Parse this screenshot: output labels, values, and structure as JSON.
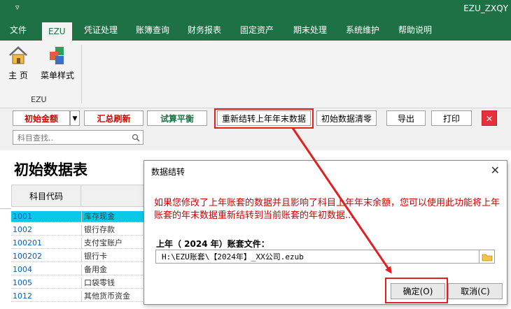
{
  "titlebar": {
    "quick_access": "▿",
    "app_title": "EZU_ZXQY"
  },
  "tabs": [
    {
      "label": "文件"
    },
    {
      "label": "EZU"
    },
    {
      "label": "凭证处理"
    },
    {
      "label": "账簿查询"
    },
    {
      "label": "财务报表"
    },
    {
      "label": "固定资产"
    },
    {
      "label": "期末处理"
    },
    {
      "label": "系统维护"
    },
    {
      "label": "帮助说明"
    }
  ],
  "ribbon": {
    "home_label": "主 页",
    "menu_style_label": "菜单样式",
    "group_label": "EZU"
  },
  "toolbar": {
    "initial_amount": "初始金额",
    "summary_refresh": "汇总刷新",
    "trial_balance": "试算平衡",
    "recarry": "重新结转上年年末数据",
    "clear_initial": "初始数据清零",
    "export": "导出",
    "print": "打印",
    "close": "✕",
    "search_placeholder": "科目查找.."
  },
  "main": {
    "title": "初始数据表",
    "col_code": "科目代码",
    "rows": [
      {
        "code": "1001",
        "name": "库存现金"
      },
      {
        "code": "1002",
        "name": "银行存款"
      },
      {
        "code": "100201",
        "name": "支付宝账户"
      },
      {
        "code": "100202",
        "name": "银行卡"
      },
      {
        "code": "1004",
        "name": "备用金"
      },
      {
        "code": "1005",
        "name": "口袋零钱"
      },
      {
        "code": "1012",
        "name": "其他货币资金"
      }
    ]
  },
  "dialog": {
    "title": "数据结转",
    "message": "如果您修改了上年账套的数据并且影响了科目上年年末余额，您可以使用此功能将上年账套的年末数据重新结转到当前账套的年初数据...",
    "file_label": "上年（ 2024 年）账套文件：",
    "file_path": "H:\\EZU账套\\【2024年】_XX公司.ezub",
    "ok": "确定(O)",
    "cancel": "取消(C)"
  },
  "colors": {
    "brand": "#1e7145",
    "alert_red": "#d00000",
    "selection": "#0cc8e8",
    "highlight": "#e02020"
  }
}
